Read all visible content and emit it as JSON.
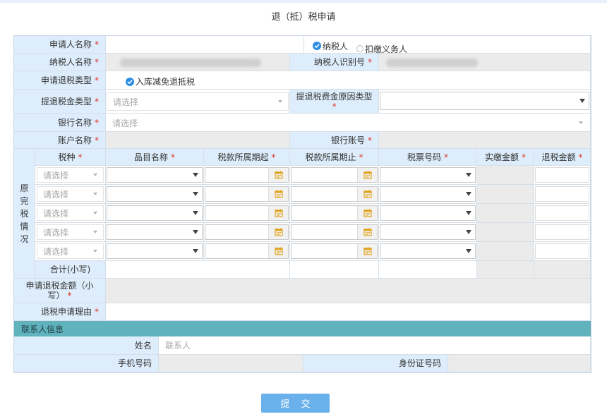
{
  "title": "退（抵）税申请",
  "star": "*",
  "fields": {
    "applicant_name": "申请人名称",
    "taxpayer_radio": "纳税人",
    "withholding_radio": "扣缴义务人",
    "taxpayer_name": "纳税人名称",
    "taxpayer_id": "纳税人识别号",
    "refund_type": "申请退税类型",
    "refund_type_option": "入库减免退抵税",
    "refund_category": "提退税金类型",
    "refund_category_placeholder": "请选择",
    "refund_reason_type": "提退税费金原因类型",
    "bank_name": "银行名称",
    "bank_name_placeholder": "请选择",
    "account_name": "账户名称",
    "bank_account": "银行账号"
  },
  "original_tax": {
    "section_label": [
      "原",
      "完",
      "税",
      "情",
      "况"
    ],
    "headers": [
      "税种",
      "品目名称",
      "税款所属期起",
      "税款所属期止",
      "税票号码",
      "实缴金额",
      "退税金额"
    ],
    "row_placeholder": "请选择",
    "rows": 5,
    "total_label": "合计(小写)"
  },
  "refund_amount_label": "申请退税金额（小写）",
  "refund_reason_label": "退税申请理由",
  "contact": {
    "section_title": "联系人信息",
    "name_label": "姓名",
    "name_placeholder": "联系人",
    "phone_label": "手机号码",
    "id_label": "身份证号码"
  },
  "submit_label": "提 交",
  "colors": {
    "label_bg": "#deedfb",
    "section_bg": "#60b2bd",
    "submit_bg": "#6ab1ec",
    "required_star": "#e0362c",
    "check_blue": "#2c8de2"
  }
}
